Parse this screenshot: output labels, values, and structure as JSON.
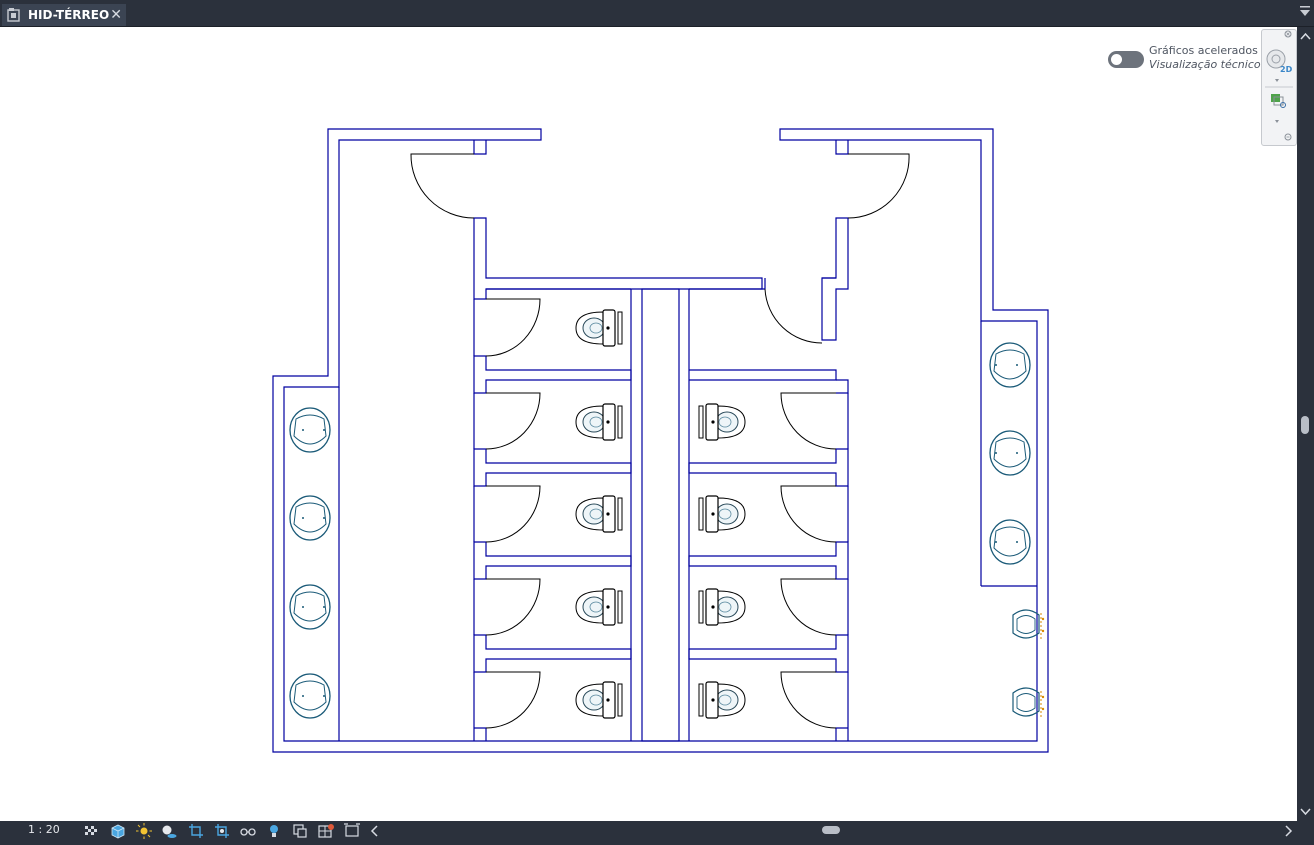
{
  "tab": {
    "title": "HID-TÉRREO",
    "close_glyph": "✕"
  },
  "overlay": {
    "gfx_label": "Gráficos acelerados",
    "gfx_sublabel": "Visualização técnico"
  },
  "navbar": {
    "view_mode": "2D"
  },
  "status": {
    "scale": "1 : 20"
  },
  "colors": {
    "wall": "#0000a0",
    "fixture": "#1a5a78",
    "door": "#000000",
    "accent_orange": "#d98a00"
  }
}
